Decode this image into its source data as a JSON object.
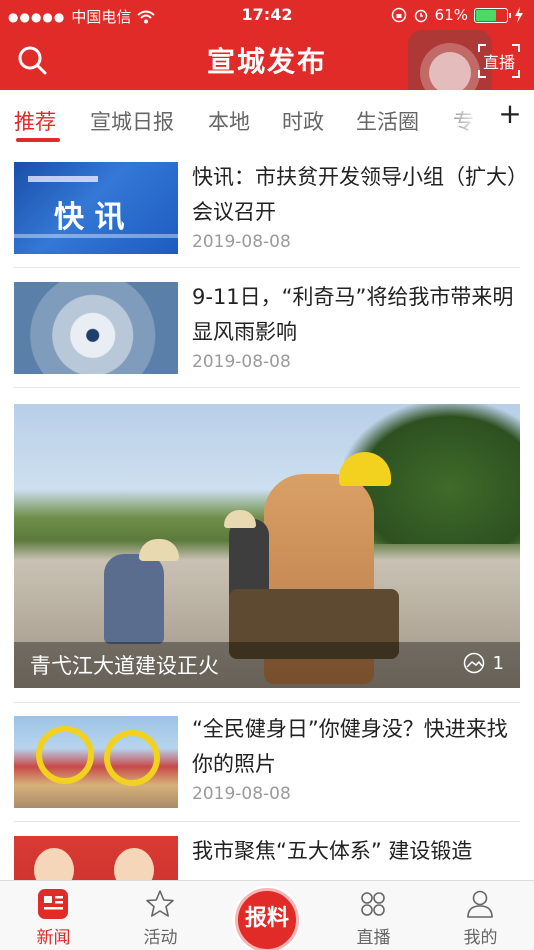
{
  "status_bar": {
    "signal": "●●●●●",
    "carrier": "中国电信",
    "time": "17:42",
    "battery": "61%",
    "battery_fill": 0.61
  },
  "header": {
    "title": "宣城发布",
    "live_label": "直播",
    "icons": {
      "search": "search-icon",
      "live": "live-icon"
    },
    "brand_color": "#e02b28"
  },
  "tabs": [
    {
      "label": "推荐",
      "active": true
    },
    {
      "label": "宣城日报"
    },
    {
      "label": "本地"
    },
    {
      "label": "时政"
    },
    {
      "label": "生活圈"
    },
    {
      "label": "专"
    }
  ],
  "tab_add": "+",
  "news": [
    {
      "title": "快讯：市扶贫开发领导小组（扩大）会议召开",
      "date": "2019-08-08",
      "thumb_text": "快 讯"
    },
    {
      "title": "9-11日，“利奇马”将给我市带来明显风雨影响",
      "date": "2019-08-08"
    }
  ],
  "featured": {
    "caption": "青弋江大道建设正火",
    "count": "1"
  },
  "news_more": [
    {
      "title": "“全民健身日”你健身没？快进来找你的照片",
      "date": "2019-08-08"
    },
    {
      "title": "我市聚焦“五大体系” 建设锻造"
    }
  ],
  "tabbar": {
    "items": [
      {
        "label": "新闻",
        "icon": "news-icon",
        "active": true
      },
      {
        "label": "活动",
        "icon": "star-icon"
      },
      {
        "label": "直播",
        "icon": "grid-icon"
      },
      {
        "label": "我的",
        "icon": "user-icon"
      }
    ],
    "report_label": "报料"
  }
}
